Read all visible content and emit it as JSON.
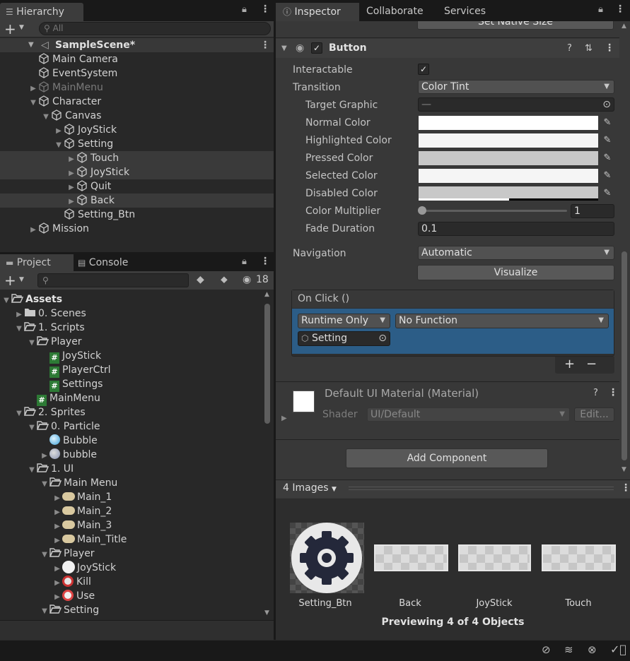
{
  "hierarchy": {
    "tab": "Hierarchy",
    "search_placeholder": "All",
    "scene": "SampleScene*",
    "items": [
      {
        "label": "Main Camera",
        "depth": 2,
        "arrow": "",
        "dim": false,
        "sel": false
      },
      {
        "label": "EventSystem",
        "depth": 2,
        "arrow": "",
        "dim": false,
        "sel": false
      },
      {
        "label": "MainMenu",
        "depth": 2,
        "arrow": "right",
        "dim": true,
        "sel": false
      },
      {
        "label": "Character",
        "depth": 2,
        "arrow": "down",
        "dim": false,
        "sel": false
      },
      {
        "label": "Canvas",
        "depth": 3,
        "arrow": "down",
        "dim": false,
        "sel": false
      },
      {
        "label": "JoyStick",
        "depth": 4,
        "arrow": "right",
        "dim": false,
        "sel": false
      },
      {
        "label": "Setting",
        "depth": 4,
        "arrow": "down",
        "dim": false,
        "sel": false
      },
      {
        "label": "Touch",
        "depth": 5,
        "arrow": "right",
        "dim": false,
        "sel": true
      },
      {
        "label": "JoyStick",
        "depth": 5,
        "arrow": "right",
        "dim": false,
        "sel": true
      },
      {
        "label": "Quit",
        "depth": 5,
        "arrow": "right",
        "dim": false,
        "sel": false
      },
      {
        "label": "Back",
        "depth": 5,
        "arrow": "right",
        "dim": false,
        "sel": true
      },
      {
        "label": "Setting_Btn",
        "depth": 4,
        "arrow": "",
        "dim": false,
        "sel": false
      },
      {
        "label": "Mission",
        "depth": 2,
        "arrow": "right",
        "dim": false,
        "sel": false
      }
    ]
  },
  "project": {
    "tab_project": "Project",
    "tab_console": "Console",
    "hidden_count": "18",
    "items": [
      {
        "label": "Assets",
        "depth": 0,
        "arrow": "down",
        "icon": "folder-open",
        "bold": true
      },
      {
        "label": "0. Scenes",
        "depth": 1,
        "arrow": "right",
        "icon": "folder"
      },
      {
        "label": "1. Scripts",
        "depth": 1,
        "arrow": "down",
        "icon": "folder-open"
      },
      {
        "label": "Player",
        "depth": 2,
        "arrow": "down",
        "icon": "folder-open"
      },
      {
        "label": "JoyStick",
        "depth": 3,
        "arrow": "",
        "icon": "script"
      },
      {
        "label": "PlayerCtrl",
        "depth": 3,
        "arrow": "",
        "icon": "script"
      },
      {
        "label": "Settings",
        "depth": 3,
        "arrow": "",
        "icon": "script"
      },
      {
        "label": "MainMenu",
        "depth": 2,
        "arrow": "",
        "icon": "script"
      },
      {
        "label": "2. Sprites",
        "depth": 1,
        "arrow": "down",
        "icon": "folder-open"
      },
      {
        "label": "0. Particle",
        "depth": 2,
        "arrow": "down",
        "icon": "folder-open"
      },
      {
        "label": "Bubble",
        "depth": 3,
        "arrow": "",
        "icon": "bubble"
      },
      {
        "label": "bubble",
        "depth": 3,
        "arrow": "right",
        "icon": "bubble2"
      },
      {
        "label": "1. UI",
        "depth": 2,
        "arrow": "down",
        "icon": "folder-open"
      },
      {
        "label": "Main Menu",
        "depth": 3,
        "arrow": "down",
        "icon": "folder-open"
      },
      {
        "label": "Main_1",
        "depth": 4,
        "arrow": "right",
        "icon": "sprite"
      },
      {
        "label": "Main_2",
        "depth": 4,
        "arrow": "right",
        "icon": "sprite"
      },
      {
        "label": "Main_3",
        "depth": 4,
        "arrow": "right",
        "icon": "sprite"
      },
      {
        "label": "Main_Title",
        "depth": 4,
        "arrow": "right",
        "icon": "sprite"
      },
      {
        "label": "Player",
        "depth": 3,
        "arrow": "down",
        "icon": "folder-open"
      },
      {
        "label": "JoyStick",
        "depth": 4,
        "arrow": "right",
        "icon": "white-circle"
      },
      {
        "label": "Kill",
        "depth": 4,
        "arrow": "right",
        "icon": "kill"
      },
      {
        "label": "Use",
        "depth": 4,
        "arrow": "right",
        "icon": "use"
      },
      {
        "label": "Setting",
        "depth": 3,
        "arrow": "down",
        "icon": "folder-open"
      }
    ]
  },
  "inspector": {
    "tabs": [
      "Inspector",
      "Collaborate",
      "Services"
    ],
    "set_native_size": "Set Native Size",
    "component_title": "Button",
    "interactable_label": "Interactable",
    "transition_label": "Transition",
    "transition_value": "Color Tint",
    "target_graphic_label": "Target Graphic",
    "target_graphic_value": "—",
    "normal_color_label": "Normal Color",
    "highlighted_color_label": "Highlighted Color",
    "pressed_color_label": "Pressed Color",
    "selected_color_label": "Selected Color",
    "disabled_color_label": "Disabled Color",
    "color_multiplier_label": "Color Multiplier",
    "color_multiplier_value": "1",
    "fade_duration_label": "Fade Duration",
    "fade_duration_value": "0.1",
    "navigation_label": "Navigation",
    "navigation_value": "Automatic",
    "visualize_label": "Visualize",
    "onclick_header": "On Click ()",
    "runtime_value": "Runtime Only",
    "function_value": "No Function",
    "object_value": "Setting",
    "plus": "+",
    "minus": "−",
    "material_title": "Default UI Material (Material)",
    "shader_label": "Shader",
    "shader_value": "UI/Default",
    "edit_label": "Edit...",
    "add_component": "Add Component",
    "preview_dropdown": "4 Images",
    "previews": [
      "Setting_Btn",
      "Back",
      "JoyStick",
      "Touch"
    ],
    "preview_status": "Previewing 4 of 4 Objects"
  },
  "colors": {
    "normal": "#ffffff",
    "highlighted": "#f5f5f5",
    "pressed": "#c8c8c8",
    "selected": "#f5f5f5",
    "disabled": "#c8c8c8"
  }
}
